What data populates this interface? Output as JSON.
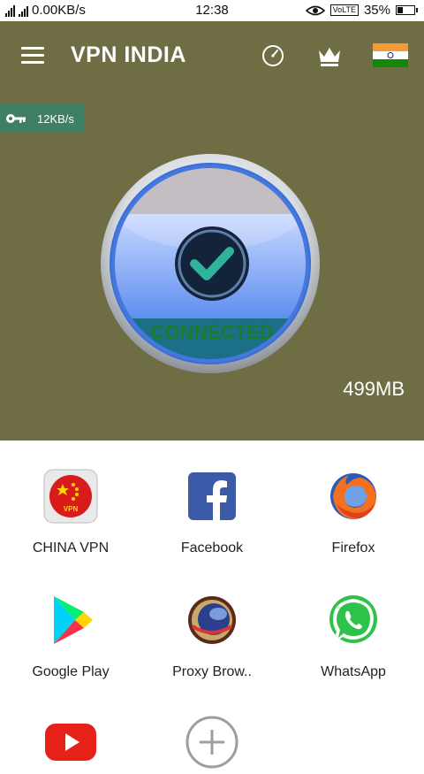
{
  "status_bar": {
    "net_speed": "0.00KB/s",
    "time": "12:38",
    "volte": "VoLTE",
    "battery_percent": "35%",
    "battery_level": 0.35
  },
  "header": {
    "title": "VPN INDIA",
    "speed_badge": "12KB/s"
  },
  "vpn": {
    "status": "CONNECTED",
    "data_used": "499MB"
  },
  "apps": [
    {
      "label": "CHINA VPN",
      "icon": "china-vpn-icon",
      "badge": "VPN"
    },
    {
      "label": "Facebook",
      "icon": "facebook-icon"
    },
    {
      "label": "Firefox",
      "icon": "firefox-icon"
    },
    {
      "label": "Google Play",
      "icon": "google-play-icon"
    },
    {
      "label": "Proxy Brow..",
      "icon": "proxy-browser-icon"
    },
    {
      "label": "WhatsApp",
      "icon": "whatsapp-icon"
    },
    {
      "label": "",
      "icon": "youtube-icon"
    },
    {
      "label": "",
      "icon": "add-icon"
    }
  ],
  "colors": {
    "hero_bg": "#6f6d44",
    "badge_bg": "#3f7f66",
    "connected_text": "#1d7a2a",
    "saffron": "#f39a34",
    "india_green": "#138808"
  }
}
